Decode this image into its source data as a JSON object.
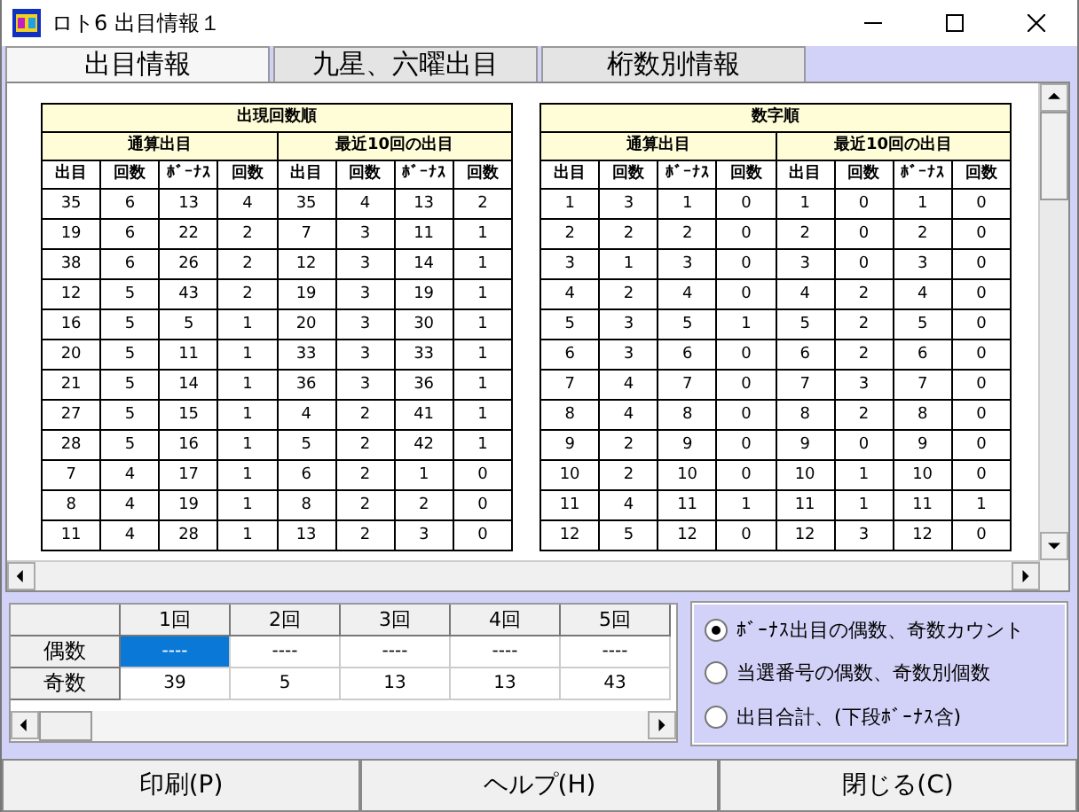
{
  "window": {
    "title": "ロト6 出目情報１"
  },
  "tabs": [
    {
      "label": "出目情報",
      "selected": true
    },
    {
      "label": "九星、六曜出目",
      "selected": false
    },
    {
      "label": "桁数別情報",
      "selected": false
    }
  ],
  "tables": [
    {
      "title": "出現回数順",
      "groups": [
        "通算出目",
        "最近10回の出目"
      ],
      "columns": [
        "出目",
        "回数",
        "ﾎﾞｰﾅｽ",
        "回数",
        "出目",
        "回数",
        "ﾎﾞｰﾅｽ",
        "回数"
      ],
      "rows": [
        [
          "35",
          "6",
          "13",
          "4",
          "35",
          "4",
          "13",
          "2"
        ],
        [
          "19",
          "6",
          "22",
          "2",
          "7",
          "3",
          "11",
          "1"
        ],
        [
          "38",
          "6",
          "26",
          "2",
          "12",
          "3",
          "14",
          "1"
        ],
        [
          "12",
          "5",
          "43",
          "2",
          "19",
          "3",
          "19",
          "1"
        ],
        [
          "16",
          "5",
          "5",
          "1",
          "20",
          "3",
          "30",
          "1"
        ],
        [
          "20",
          "5",
          "11",
          "1",
          "33",
          "3",
          "33",
          "1"
        ],
        [
          "21",
          "5",
          "14",
          "1",
          "36",
          "3",
          "36",
          "1"
        ],
        [
          "27",
          "5",
          "15",
          "1",
          "4",
          "2",
          "41",
          "1"
        ],
        [
          "28",
          "5",
          "16",
          "1",
          "5",
          "2",
          "42",
          "1"
        ],
        [
          "7",
          "4",
          "17",
          "1",
          "6",
          "2",
          "1",
          "0"
        ],
        [
          "8",
          "4",
          "19",
          "1",
          "8",
          "2",
          "2",
          "0"
        ],
        [
          "11",
          "4",
          "28",
          "1",
          "13",
          "2",
          "3",
          "0"
        ]
      ]
    },
    {
      "title": "数字順",
      "groups": [
        "通算出目",
        "最近10回の出目"
      ],
      "columns": [
        "出目",
        "回数",
        "ﾎﾞｰﾅｽ",
        "回数",
        "出目",
        "回数",
        "ﾎﾞｰﾅｽ",
        "回数"
      ],
      "rows": [
        [
          "1",
          "3",
          "1",
          "0",
          "1",
          "0",
          "1",
          "0"
        ],
        [
          "2",
          "2",
          "2",
          "0",
          "2",
          "0",
          "2",
          "0"
        ],
        [
          "3",
          "1",
          "3",
          "0",
          "3",
          "0",
          "3",
          "0"
        ],
        [
          "4",
          "2",
          "4",
          "0",
          "4",
          "2",
          "4",
          "0"
        ],
        [
          "5",
          "3",
          "5",
          "1",
          "5",
          "2",
          "5",
          "0"
        ],
        [
          "6",
          "3",
          "6",
          "0",
          "6",
          "2",
          "6",
          "0"
        ],
        [
          "7",
          "4",
          "7",
          "0",
          "7",
          "3",
          "7",
          "0"
        ],
        [
          "8",
          "4",
          "8",
          "0",
          "8",
          "2",
          "8",
          "0"
        ],
        [
          "9",
          "2",
          "9",
          "0",
          "9",
          "0",
          "9",
          "0"
        ],
        [
          "10",
          "2",
          "10",
          "0",
          "10",
          "1",
          "10",
          "0"
        ],
        [
          "11",
          "4",
          "11",
          "1",
          "11",
          "1",
          "11",
          "1"
        ],
        [
          "12",
          "5",
          "12",
          "0",
          "12",
          "3",
          "12",
          "0"
        ]
      ]
    }
  ],
  "summary_grid": {
    "columns": [
      "1回",
      "2回",
      "3回",
      "4回",
      "5回"
    ],
    "rows": [
      {
        "label": "偶数",
        "cells": [
          {
            "text": "----",
            "selected": true
          },
          {
            "text": "----",
            "selected": false
          },
          {
            "text": "----",
            "selected": false
          },
          {
            "text": "----",
            "selected": false
          },
          {
            "text": "----",
            "selected": false
          }
        ]
      },
      {
        "label": "奇数",
        "cells": [
          {
            "text": "39",
            "selected": false
          },
          {
            "text": "5",
            "selected": false
          },
          {
            "text": "13",
            "selected": false
          },
          {
            "text": "13",
            "selected": false
          },
          {
            "text": "43",
            "selected": false
          }
        ]
      }
    ]
  },
  "options": [
    {
      "label": "ﾎﾞｰﾅｽ出目の偶数、奇数カウント",
      "selected": true
    },
    {
      "label": "当選番号の偶数、奇数別個数",
      "selected": false
    },
    {
      "label": "出目合計、(下段ﾎﾞｰﾅｽ含)",
      "selected": false
    }
  ],
  "buttons": [
    "印刷(P)",
    "ヘルプ(H)",
    "閉じる(C)"
  ]
}
